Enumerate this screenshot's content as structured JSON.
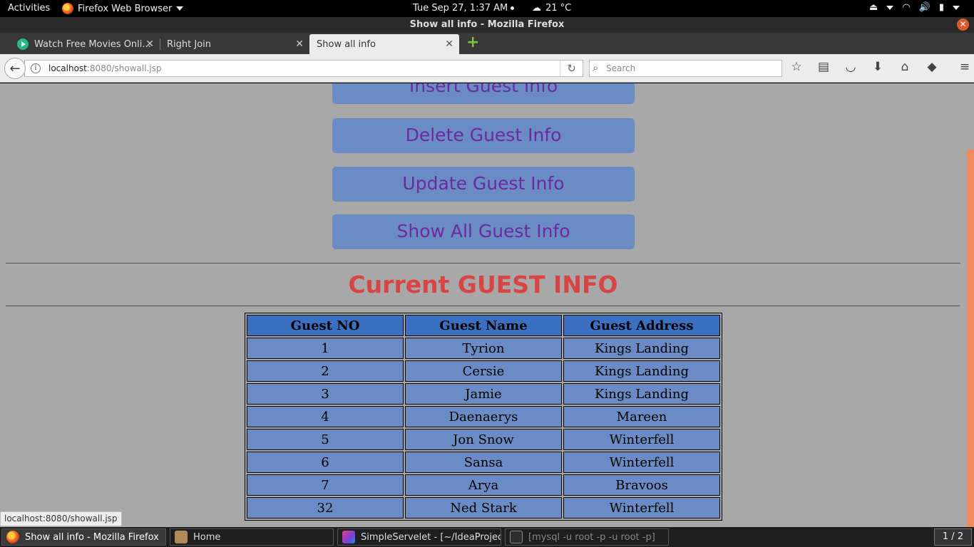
{
  "topbar": {
    "activities": "Activities",
    "app_name": "Firefox Web Browser",
    "clock": "Tue Sep 27,  1:37 AM",
    "weather": "21 °C"
  },
  "window": {
    "title": "Show all info - Mozilla Firefox"
  },
  "tabs": [
    {
      "label": "Watch Free Movies Onli..."
    },
    {
      "label": "Right Join"
    },
    {
      "label": "Show all info"
    }
  ],
  "navbar": {
    "url_host": "localhost",
    "url_rest": ":8080/showall.jsp",
    "search_placeholder": "Search"
  },
  "page": {
    "buttons": [
      {
        "label": "Insert Guest Info"
      },
      {
        "label": "Delete Guest Info"
      },
      {
        "label": "Update Guest Info"
      },
      {
        "label": "Show All Guest Info"
      }
    ],
    "heading": "Current GUEST INFO",
    "table": {
      "headers": [
        "Guest NO",
        "Guest Name",
        "Guest Address"
      ],
      "rows": [
        [
          "1",
          "Tyrion",
          "Kings Landing"
        ],
        [
          "2",
          "Cersie",
          "Kings Landing"
        ],
        [
          "3",
          "Jamie",
          "Kings Landing"
        ],
        [
          "4",
          "Daenaerys",
          "Mareen"
        ],
        [
          "5",
          "Jon Snow",
          "Winterfell"
        ],
        [
          "6",
          "Sansa",
          "Winterfell"
        ],
        [
          "7",
          "Arya",
          "Bravoos"
        ],
        [
          "32",
          "Ned Stark",
          "Winterfell"
        ]
      ]
    }
  },
  "status_link": "localhost:8080/showall.jsp",
  "taskbar": {
    "items": [
      {
        "label": "Show all info - Mozilla Firefox"
      },
      {
        "label": "Home"
      },
      {
        "label": "SimpleServelet - [~/IdeaProjects/..."
      },
      {
        "label": "[mysql -u root -p -u root -p]"
      }
    ],
    "workspace": "1 / 2"
  }
}
